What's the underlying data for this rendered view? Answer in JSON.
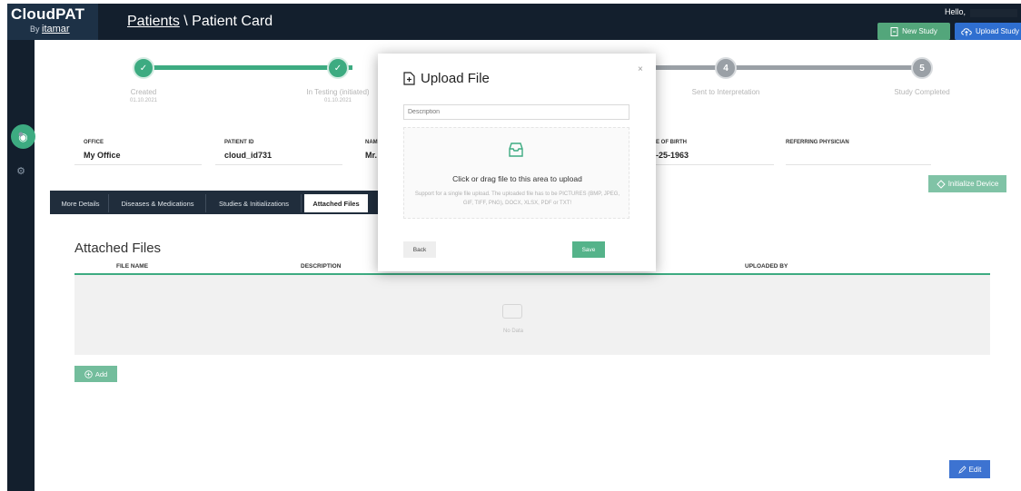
{
  "header": {
    "logo_main": "CloudPAT",
    "logo_by": "By",
    "logo_brand": "itamar",
    "breadcrumb_link": "Patients",
    "breadcrumb_sep": " \\ ",
    "breadcrumb_current": "Patient Card",
    "hello": "Hello,",
    "new_study": "New Study",
    "upload_study": "Upload Study"
  },
  "stepper": {
    "steps": [
      {
        "label": "Created",
        "date": "01.10.2021",
        "done": true,
        "symbol": "✓"
      },
      {
        "label": "In Testing (initiated)",
        "date": "01.10.2021",
        "done": true,
        "symbol": "✓"
      },
      {
        "label": "Sent to Interpretation",
        "date": "",
        "done": false,
        "symbol": "4"
      },
      {
        "label": "Study Completed",
        "date": "",
        "done": false,
        "symbol": "5"
      }
    ]
  },
  "patient_info": {
    "office_label": "OFFICE",
    "office_value": "My Office",
    "patient_id_label": "PATIENT ID",
    "patient_id_value": "cloud_id731",
    "name_label": "NAM",
    "name_value": "Mr.",
    "dob_label": "E OF BIRTH",
    "dob_value": "-25-1963",
    "physician_label": "REFERRING PHYSICIAN",
    "initialize_device": "Initialize Device"
  },
  "tabs": [
    {
      "label": "More Details"
    },
    {
      "label": "Diseases & Medications"
    },
    {
      "label": "Studies & Initializations"
    },
    {
      "label": "Attached Files",
      "active": true
    }
  ],
  "attached": {
    "title": "Attached Files",
    "columns": [
      "FILE NAME",
      "DESCRIPTION",
      "UPLOADED BY"
    ],
    "empty_text": "No Data",
    "add": "Add"
  },
  "edit": "Edit",
  "modal": {
    "title": "Upload File",
    "close": "×",
    "description_placeholder": "Description",
    "drop_main": "Click or drag file to this area to upload",
    "drop_hint": "Support for a single file upload. The uploaded file has to be PICTURES (BMP, JPEG, GIF, TIFF, PNG), DOCX, XLSX, PDF or TXT!",
    "back": "Back",
    "save": "Save"
  },
  "colors": {
    "navy": "#131f2d",
    "green": "#3dab81",
    "blue": "#2f6fd0",
    "step_todo": "#9aa0a6"
  }
}
